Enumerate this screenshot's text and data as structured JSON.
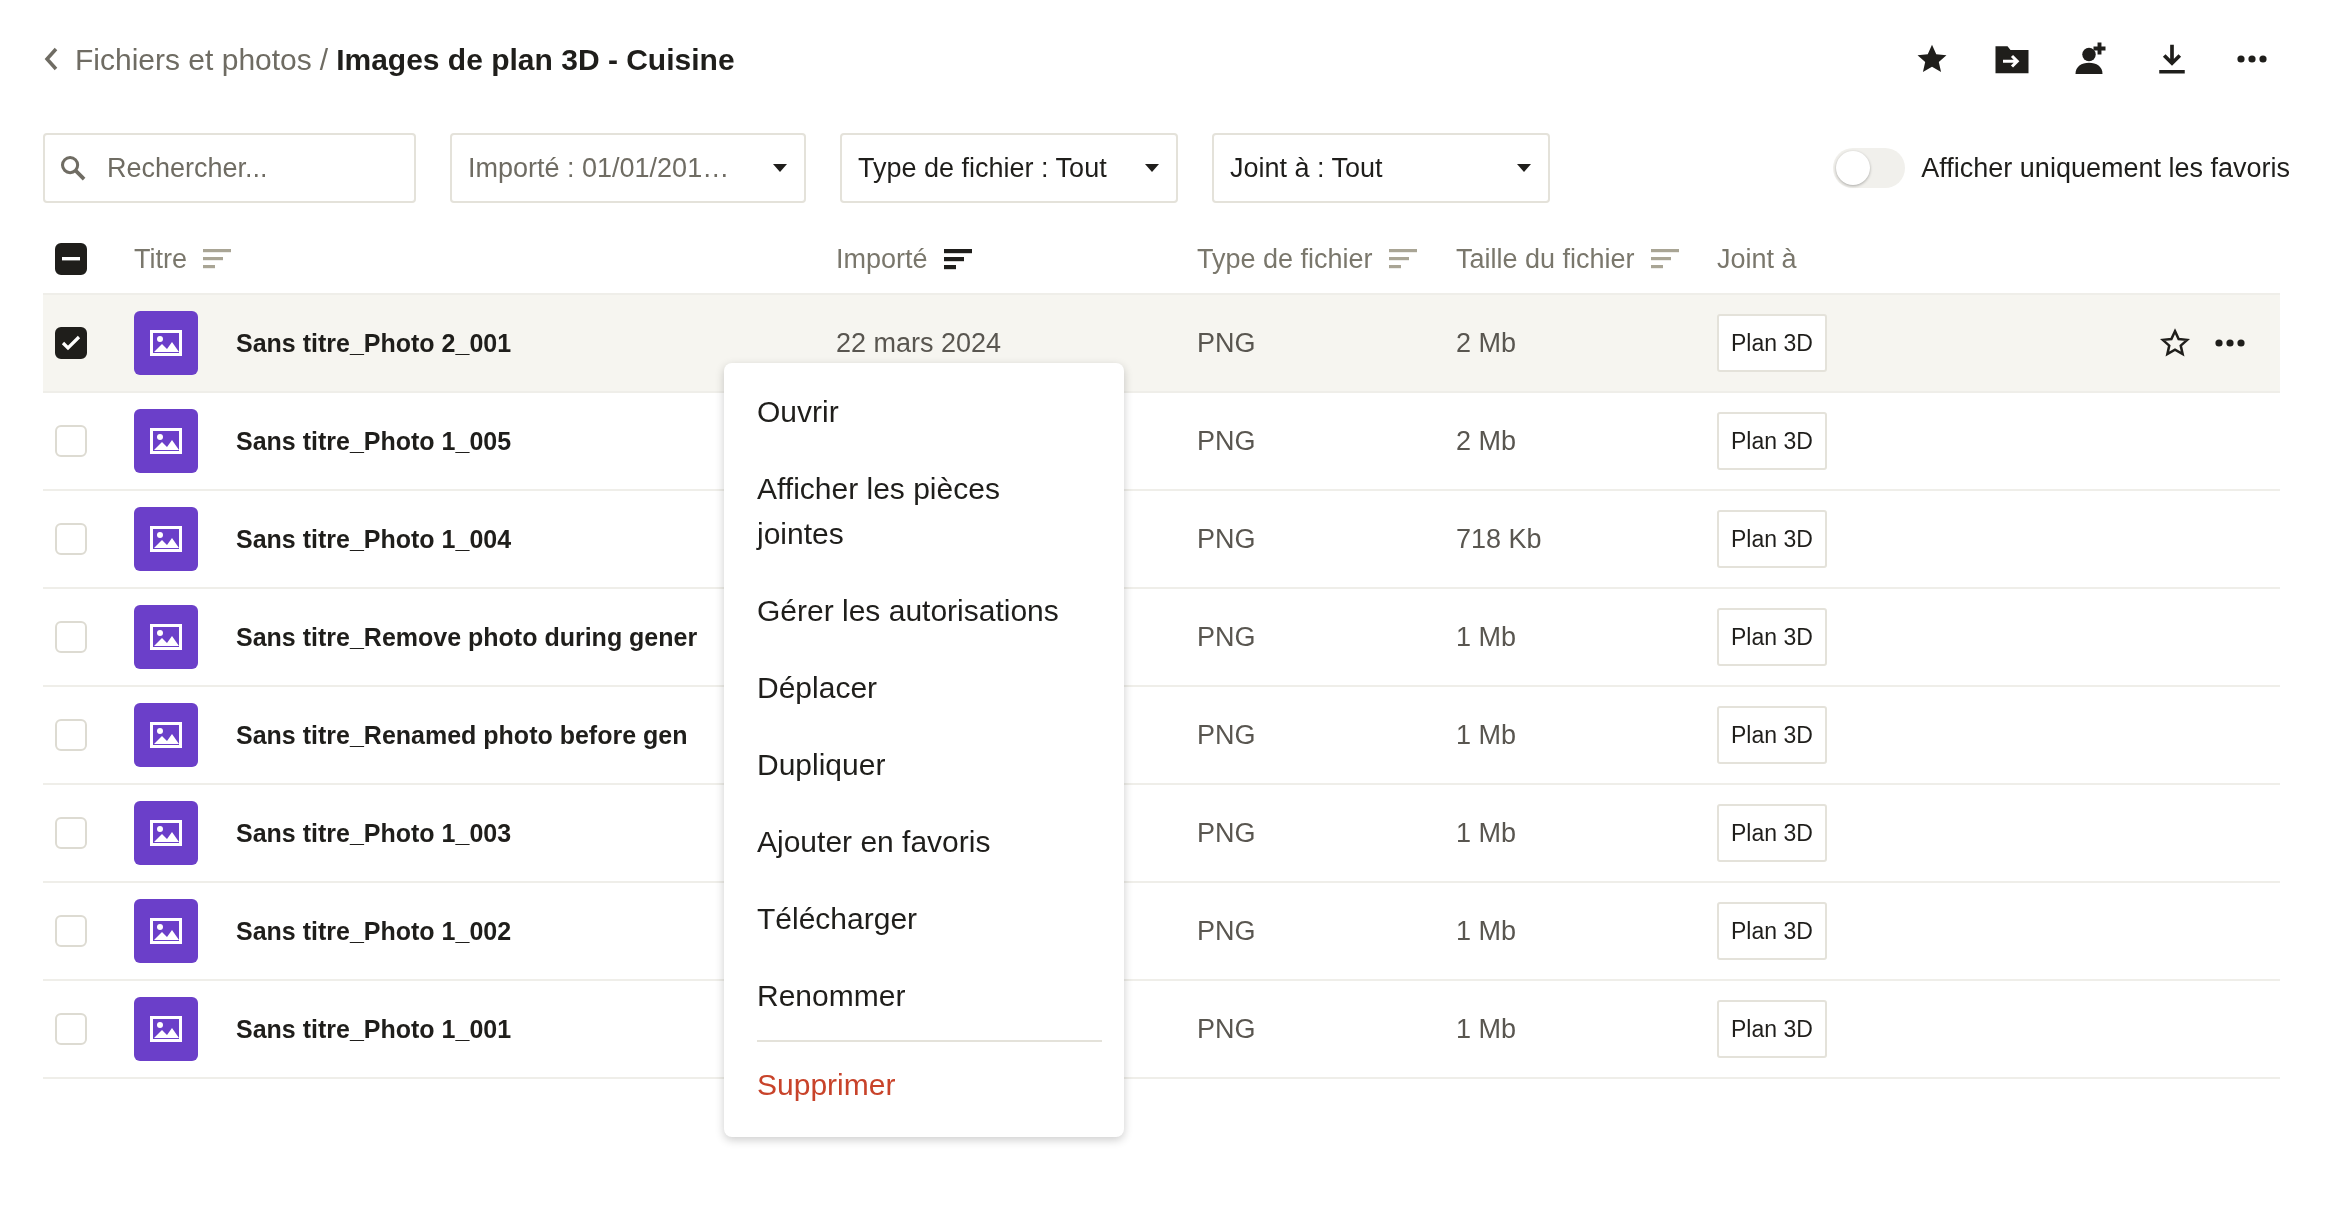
{
  "breadcrumb": {
    "parent": "Fichiers et photos",
    "separator": "/",
    "current": "Images de plan 3D - Cuisine"
  },
  "toolbar": [
    {
      "kind": "star"
    },
    {
      "kind": "move"
    },
    {
      "kind": "share"
    },
    {
      "kind": "download"
    },
    {
      "kind": "more"
    }
  ],
  "search": {
    "placeholder": "Rechercher..."
  },
  "filters": [
    {
      "label": "Importé : 01/01/201…",
      "muted": true
    },
    {
      "label": "Type de fichier : Tout",
      "muted": false
    },
    {
      "label": "Joint à : Tout",
      "muted": false
    }
  ],
  "favorites_toggle": {
    "label": "Afficher uniquement les favoris",
    "on": false
  },
  "select_all": {
    "indeterminate": true
  },
  "columns": [
    {
      "label": "Titre",
      "sortable": true,
      "sorted": false
    },
    {
      "label": "Importé",
      "sortable": true,
      "sorted": true
    },
    {
      "label": "Type de fichier",
      "sortable": true,
      "sorted": false
    },
    {
      "label": "Taille du fichier",
      "sortable": true,
      "sorted": false
    },
    {
      "label": "Joint à",
      "sortable": false
    }
  ],
  "rows": [
    {
      "title": "Sans titre_Photo 2_001",
      "imported": "22 mars 2024",
      "type": "PNG",
      "size": "2 Mb",
      "attached": "Plan 3D",
      "checked": true,
      "selected": true,
      "actions_visible": true
    },
    {
      "title": "Sans titre_Photo 1_005",
      "type": "PNG",
      "size": "2 Mb",
      "attached": "Plan 3D",
      "checked": false,
      "selected": false,
      "actions_visible": false
    },
    {
      "title": "Sans titre_Photo 1_004",
      "type": "PNG",
      "size": "718 Kb",
      "attached": "Plan 3D",
      "checked": false,
      "selected": false,
      "actions_visible": false
    },
    {
      "title": "Sans titre_Remove photo during gener",
      "type": "PNG",
      "size": "1 Mb",
      "attached": "Plan 3D",
      "checked": false,
      "selected": false,
      "actions_visible": false
    },
    {
      "title": "Sans titre_Renamed photo before gen",
      "type": "PNG",
      "size": "1 Mb",
      "attached": "Plan 3D",
      "checked": false,
      "selected": false,
      "actions_visible": false
    },
    {
      "title": "Sans titre_Photo 1_003",
      "type": "PNG",
      "size": "1 Mb",
      "attached": "Plan 3D",
      "checked": false,
      "selected": false,
      "actions_visible": false
    },
    {
      "title": "Sans titre_Photo 1_002",
      "type": "PNG",
      "size": "1 Mb",
      "attached": "Plan 3D",
      "checked": false,
      "selected": false,
      "actions_visible": false
    },
    {
      "title": "Sans titre_Photo 1_001",
      "type": "PNG",
      "size": "1 Mb",
      "attached": "Plan 3D",
      "checked": false,
      "selected": false,
      "actions_visible": false
    }
  ],
  "context_menu": [
    {
      "label": "Ouvrir",
      "kind": "normal",
      "separator_above": false
    },
    {
      "label": "Afficher les pièces jointes",
      "kind": "normal",
      "separator_above": false
    },
    {
      "label": "Gérer les autorisations",
      "kind": "normal",
      "separator_above": false
    },
    {
      "label": "Déplacer",
      "kind": "normal",
      "separator_above": false
    },
    {
      "label": "Dupliquer",
      "kind": "normal",
      "separator_above": false
    },
    {
      "label": "Ajouter en favoris",
      "kind": "normal",
      "separator_above": false
    },
    {
      "label": "Télécharger",
      "kind": "normal",
      "separator_above": false
    },
    {
      "label": "Renommer",
      "kind": "normal",
      "separator_above": false
    },
    {
      "label": "Supprimer",
      "kind": "danger",
      "separator_above": true
    }
  ]
}
